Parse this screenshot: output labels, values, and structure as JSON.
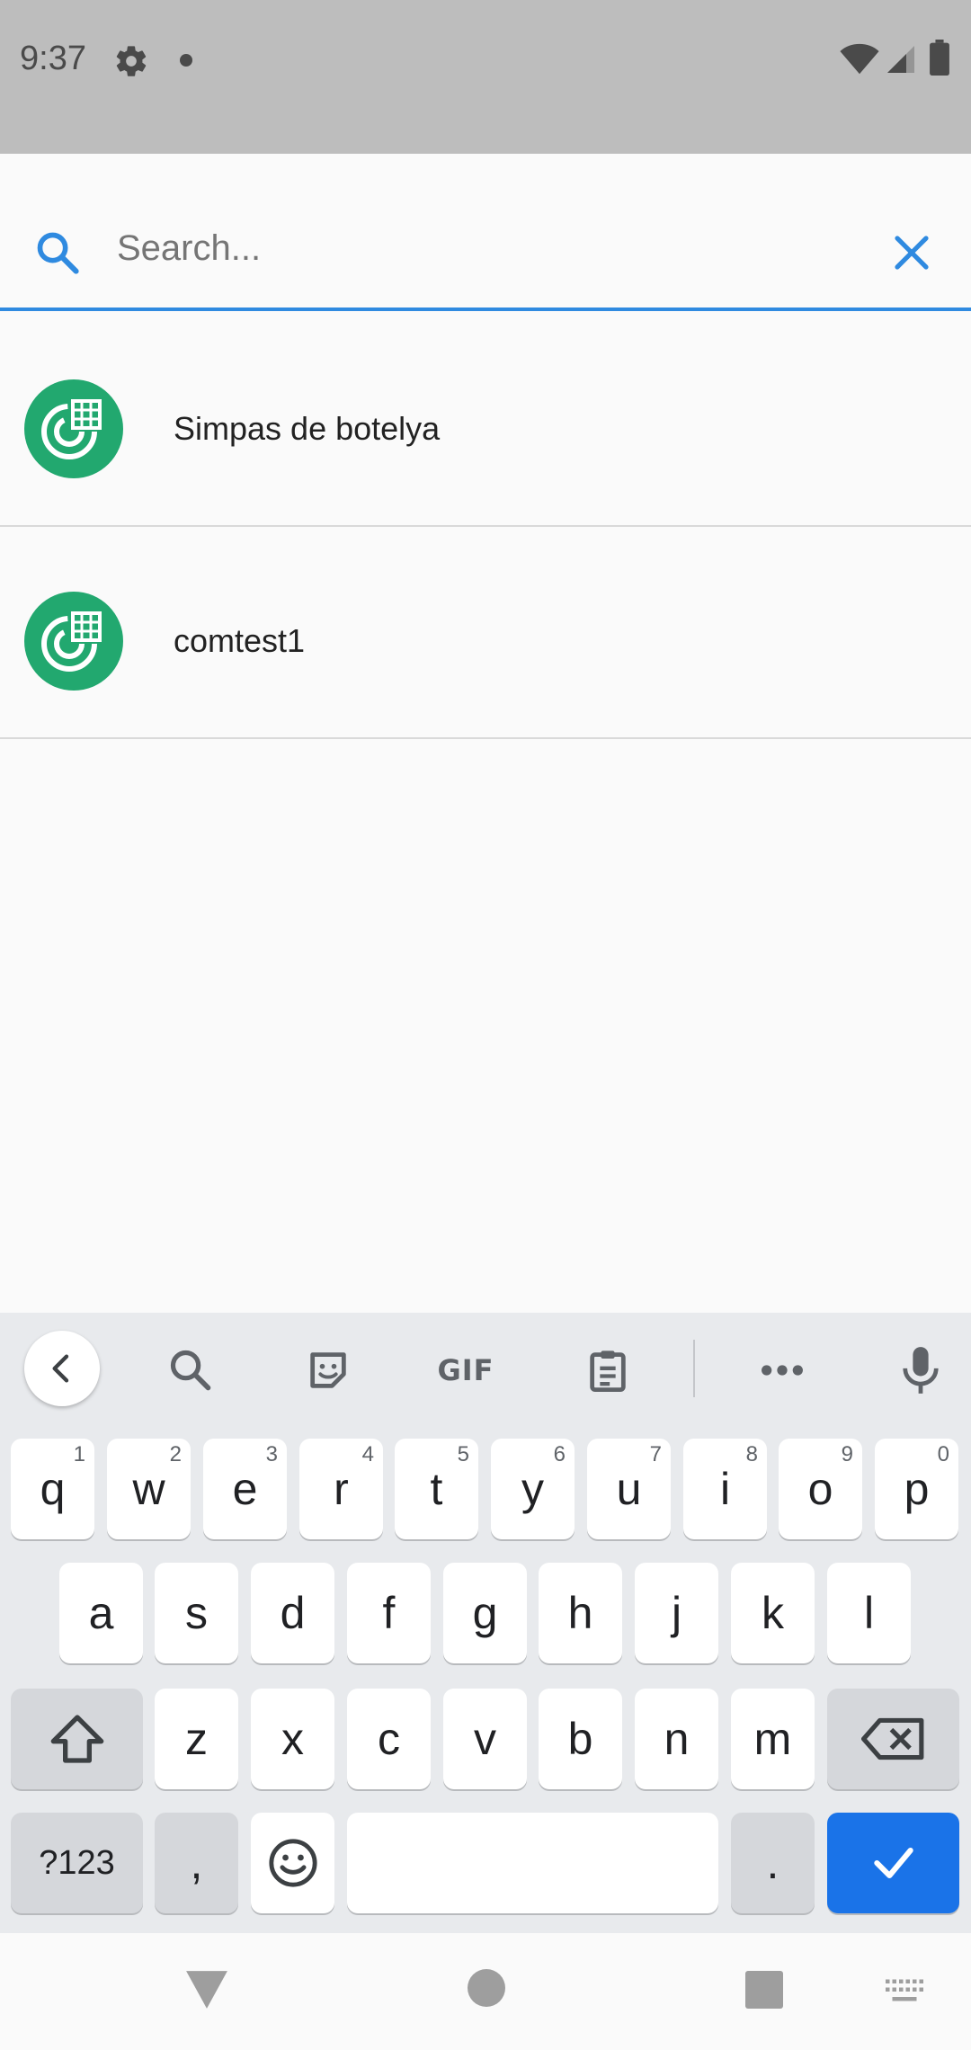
{
  "status_bar": {
    "time": "9:37",
    "icons": [
      "gear-icon",
      "dot-icon",
      "wifi-icon",
      "signal-icon",
      "battery-icon"
    ]
  },
  "search": {
    "placeholder": "Search...",
    "value": ""
  },
  "results": [
    {
      "label": "Simpas de botelya",
      "icon": "app-logo-icon"
    },
    {
      "label": "comtest1",
      "icon": "app-logo-icon"
    }
  ],
  "keyboard": {
    "toolbar": {
      "gif_label": "GIF"
    },
    "row1": [
      {
        "k": "q",
        "h": "1"
      },
      {
        "k": "w",
        "h": "2"
      },
      {
        "k": "e",
        "h": "3"
      },
      {
        "k": "r",
        "h": "4"
      },
      {
        "k": "t",
        "h": "5"
      },
      {
        "k": "y",
        "h": "6"
      },
      {
        "k": "u",
        "h": "7"
      },
      {
        "k": "i",
        "h": "8"
      },
      {
        "k": "o",
        "h": "9"
      },
      {
        "k": "p",
        "h": "0"
      }
    ],
    "row2": [
      "a",
      "s",
      "d",
      "f",
      "g",
      "h",
      "j",
      "k",
      "l"
    ],
    "row3": [
      "z",
      "x",
      "c",
      "v",
      "b",
      "n",
      "m"
    ],
    "symbols_label": "?123",
    "comma": ",",
    "period": "."
  },
  "colors": {
    "accent": "#2f8ae0",
    "avatar": "#22a86f",
    "enter": "#1a73e8"
  }
}
